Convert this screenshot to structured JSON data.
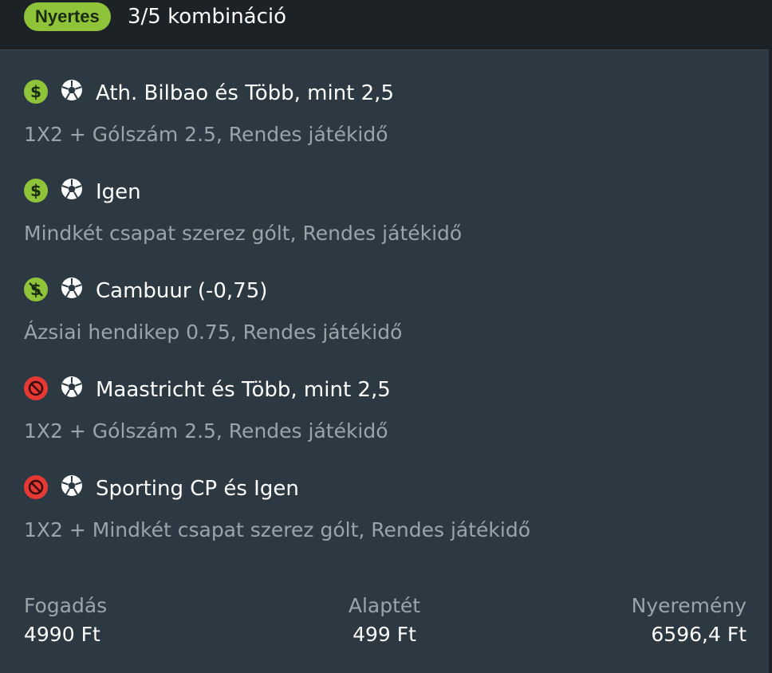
{
  "header": {
    "badge": "Nyertes",
    "title": "3/5 kombináció",
    "colors": {
      "badge": "#8fc43a",
      "bar": "#1c2226"
    }
  },
  "bets": [
    {
      "status": "won",
      "status_icon": "dollar-icon",
      "sport_icon": "soccer-ball-icon",
      "selection": "Ath. Bilbao és Több, mint 2,5",
      "market": "1X2 + Gólszám 2.5, Rendes játékidő"
    },
    {
      "status": "won",
      "status_icon": "dollar-icon",
      "sport_icon": "soccer-ball-icon",
      "selection": "Igen",
      "market": "Mindkét csapat szerez gólt, Rendes játékidő"
    },
    {
      "status": "half-won",
      "status_icon": "dollar-crossed-icon",
      "sport_icon": "soccer-ball-icon",
      "selection": "Cambuur (-0,75)",
      "market": "Ázsiai hendikep 0.75, Rendes játékidő"
    },
    {
      "status": "lost",
      "status_icon": "prohibited-icon",
      "sport_icon": "soccer-ball-icon",
      "selection": "Maastricht és Több, mint 2,5",
      "market": "1X2 + Gólszám 2.5, Rendes játékidő"
    },
    {
      "status": "lost",
      "status_icon": "prohibited-icon",
      "sport_icon": "soccer-ball-icon",
      "selection": "Sporting CP és Igen",
      "market": "1X2 + Mindkét csapat szerez gólt, Rendes játékidő"
    }
  ],
  "footer": {
    "stake_label": "Fogadás",
    "stake_value": "4990 Ft",
    "base_label": "Alaptét",
    "base_value": "499 Ft",
    "win_label": "Nyeremény",
    "win_value": "6596,4 Ft"
  },
  "colors": {
    "won": "#8fc43a",
    "lost": "#e53935",
    "background": "#2d3942",
    "muted": "#9aa4ab"
  }
}
